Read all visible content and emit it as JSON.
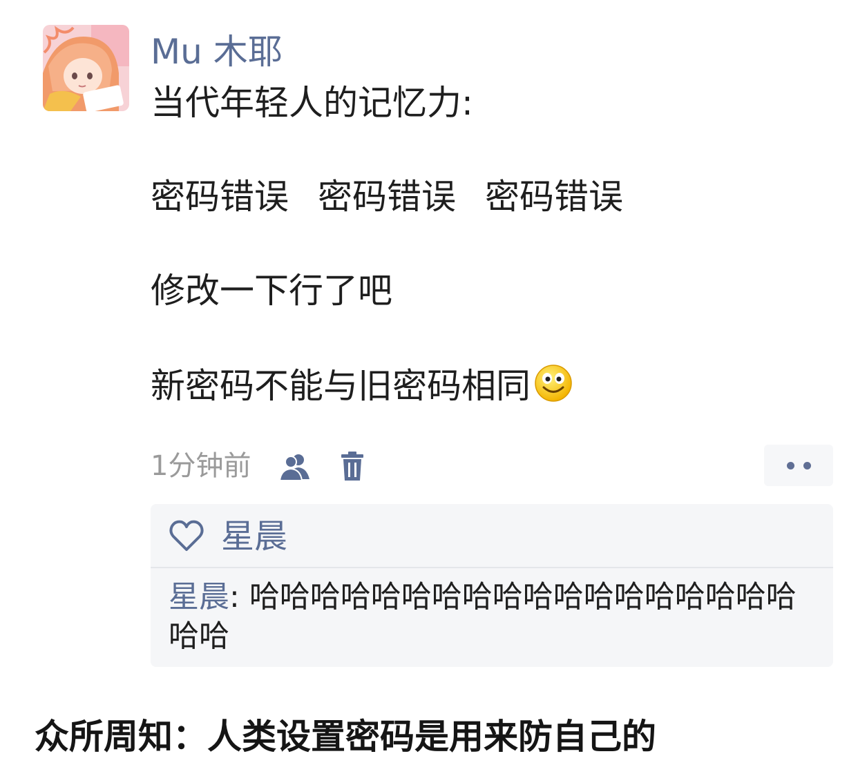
{
  "post": {
    "username": "Mu 木耶",
    "lines": [
      "当代年轻人的记忆力:",
      "密码错误",
      "密码错误",
      "密码错误",
      "修改一下行了吧",
      "新密码不能与旧密码相同"
    ],
    "emoji": "smile-emoji",
    "time": "1分钟前"
  },
  "likes": {
    "names": "星晨"
  },
  "comment": {
    "author": "星晨",
    "separator": ": ",
    "text": "哈哈哈哈哈哈哈哈哈哈哈哈哈哈哈哈哈哈哈哈"
  },
  "caption": "众所周知：人类设置密码是用来防自己的",
  "icons": {
    "visibility": "visibility-people-icon",
    "delete": "trash-icon",
    "more": "more-dots-icon",
    "like": "heart-outline-icon"
  },
  "colors": {
    "link": "#5a6d95",
    "comment_bg": "#f5f6f8",
    "meta_text": "#9a9a9a",
    "text": "#1e1e1e"
  }
}
